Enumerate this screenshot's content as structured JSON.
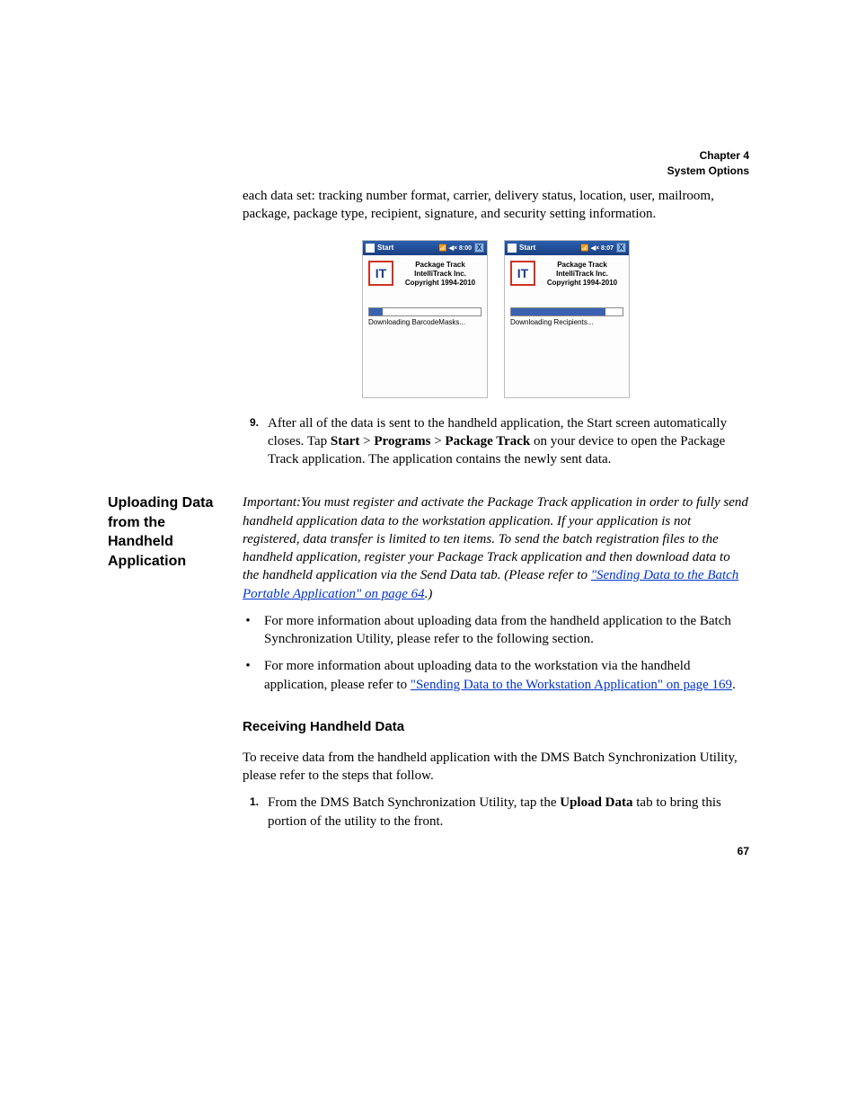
{
  "header": {
    "chapter": "Chapter 4",
    "section": "System Options"
  },
  "intro_continuation": "each data set: tracking number format, carrier, delivery status, location, user, mailroom, package, package type, recipient, signature, and security setting information.",
  "device_left": {
    "title": "Start",
    "indicators": "8:00",
    "close": "X",
    "app_name": "Package Track",
    "company": "IntelliTrack Inc.",
    "copyright": "Copyright 1994-2010",
    "status": "Downloading BarcodeMasks...",
    "progress_pct": 12
  },
  "device_right": {
    "title": "Start",
    "indicators": "8:07",
    "close": "X",
    "app_name": "Package Track",
    "company": "IntelliTrack Inc.",
    "copyright": "Copyright 1994-2010",
    "status": "Downloading Recipients...",
    "progress_pct": 85
  },
  "step9": {
    "num": "9.",
    "pre": "After all of the data is sent to the handheld application, the Start screen automatically closes. Tap ",
    "s1": "Start",
    "sep": " > ",
    "s2": "Programs",
    "s3": "Package Track",
    "post": " on your device to open the Package Track application. The application contains the newly sent data."
  },
  "upload": {
    "heading": "Uploading Data from the Handheld Application",
    "important_pre": "Important:You must register and activate the Package Track application in order to fully send handheld application data to the workstation application. If your application is not registered, data transfer is limited to ten items. To send the batch registration files to the handheld application, register your Package Track application and then download data to the handheld application via the Send Data tab. (Please refer to ",
    "link1": "\"Sending Data to the Batch Portable Application\" on page 64",
    "important_post": ".)",
    "bullet1": "For more information about uploading data from the handheld application to the Batch Synchronization Utility, please refer to the following section.",
    "bullet2_pre": "For more information about uploading data to the workstation via the handheld application, please refer to ",
    "link2": "\"Sending Data to the Workstation Application\" on page 169",
    "bullet2_post": "."
  },
  "receiving": {
    "heading": "Receiving Handheld Data",
    "intro": "To receive data from the handheld application with the DMS Batch Synchronization Utility, please refer to the steps that follow.",
    "step1_num": "1.",
    "step1_pre": "From the DMS Batch Synchronization Utility, tap the ",
    "step1_bold": "Upload Data",
    "step1_post": " tab to bring this portion of the utility to the front."
  },
  "page_number": "67"
}
